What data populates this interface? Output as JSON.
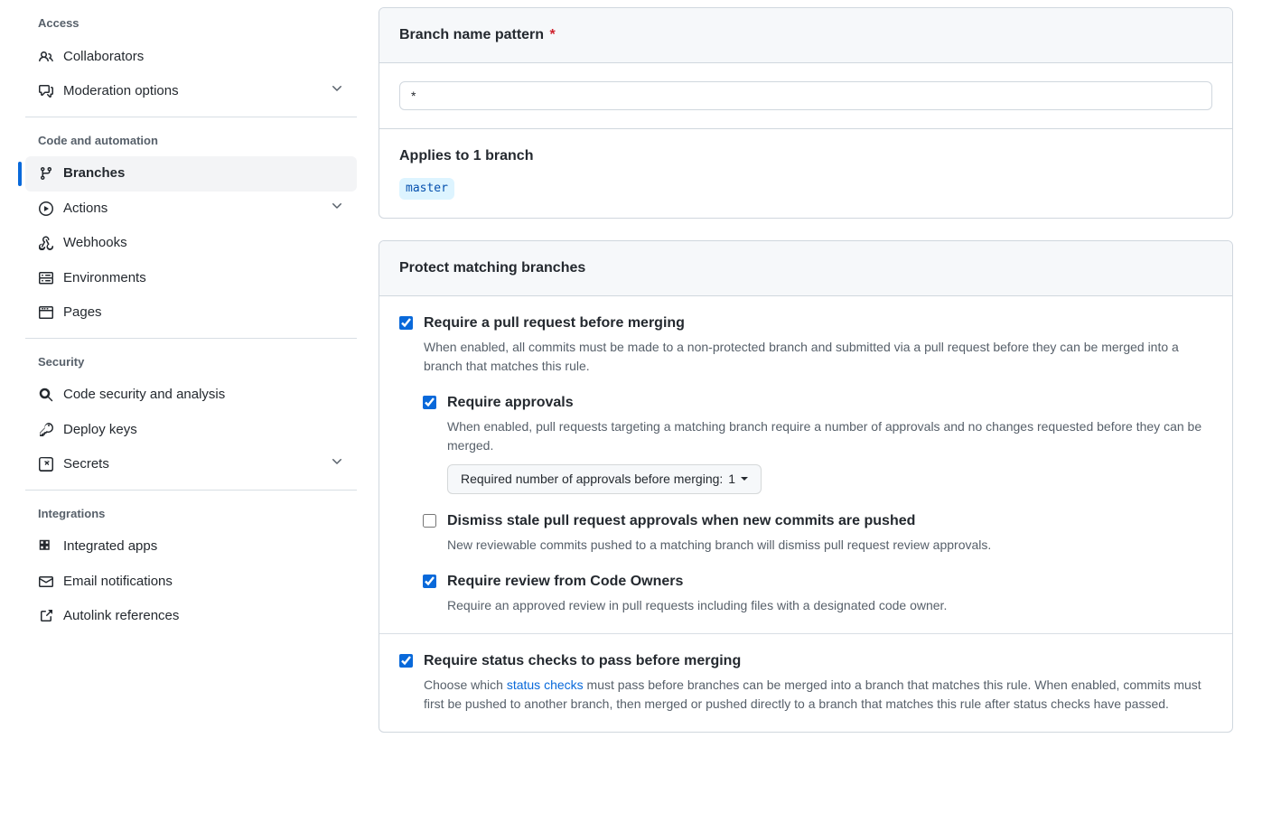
{
  "sidebar": {
    "sections": {
      "access": {
        "header": "Access",
        "collaborators": "Collaborators",
        "moderation": "Moderation options"
      },
      "code": {
        "header": "Code and automation",
        "branches": "Branches",
        "actions": "Actions",
        "webhooks": "Webhooks",
        "environments": "Environments",
        "pages": "Pages"
      },
      "security": {
        "header": "Security",
        "analysis": "Code security and analysis",
        "deploykeys": "Deploy keys",
        "secrets": "Secrets"
      },
      "integrations": {
        "header": "Integrations",
        "apps": "Integrated apps",
        "email": "Email notifications",
        "autolink": "Autolink references"
      }
    }
  },
  "main": {
    "pattern": {
      "header": "Branch name pattern",
      "value": "*",
      "applies_header": "Applies to 1 branch",
      "matched_branch": "master"
    },
    "protect": {
      "header": "Protect matching branches",
      "require_pr": {
        "title": "Require a pull request before merging",
        "desc": "When enabled, all commits must be made to a non-protected branch and submitted via a pull request before they can be merged into a branch that matches this rule."
      },
      "require_approvals": {
        "title": "Require approvals",
        "desc": "When enabled, pull requests targeting a matching branch require a number of approvals and no changes requested before they can be merged.",
        "dropdown_label": "Required number of approvals before merging: ",
        "dropdown_value": "1"
      },
      "dismiss_stale": {
        "title": "Dismiss stale pull request approvals when new commits are pushed",
        "desc": "New reviewable commits pushed to a matching branch will dismiss pull request review approvals."
      },
      "code_owners": {
        "title": "Require review from Code Owners",
        "desc": "Require an approved review in pull requests including files with a designated code owner."
      },
      "status_checks": {
        "title": "Require status checks to pass before merging",
        "desc_pre": "Choose which ",
        "desc_link": "status checks",
        "desc_post": " must pass before branches can be merged into a branch that matches this rule. When enabled, commits must first be pushed to another branch, then merged or pushed directly to a branch that matches this rule after status checks have passed."
      }
    }
  }
}
